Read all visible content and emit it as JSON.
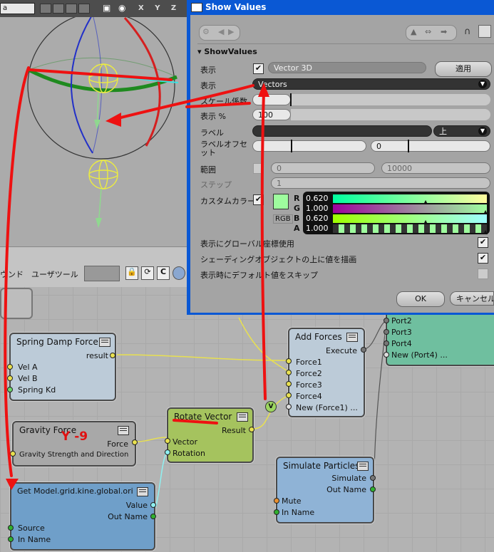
{
  "viewport": {
    "combo": "a",
    "axes_label": "X Y Z"
  },
  "node_toolbar": {
    "label1": "ウンド",
    "label2": "ユーザツール"
  },
  "nodes": {
    "spring_damp": {
      "title": "Spring Damp Force",
      "out": "result",
      "in": [
        "Vel A",
        "Vel B",
        "Spring Kd"
      ]
    },
    "gravity": {
      "title": "Gravity Force",
      "out": "Force",
      "in": [
        "Gravity Strength and Direction"
      ]
    },
    "get_model": {
      "title": "Get Model.grid.kine.global.ori",
      "out": [
        "Value",
        "Out Name"
      ],
      "in": [
        "Source",
        "In Name"
      ]
    },
    "rotate_vector": {
      "title": "Rotate Vector",
      "out": "Result",
      "in": [
        "Vector",
        "Rotation"
      ]
    },
    "add_forces": {
      "title": "Add Forces",
      "out": "Execute",
      "in": [
        "Force1",
        "Force2",
        "Force3",
        "Force4",
        "New (Force1) ..."
      ]
    },
    "simulate": {
      "title": "Simulate Particles",
      "out": [
        "Simulate",
        "Out Name"
      ],
      "in": [
        "Mute",
        "In Name"
      ]
    },
    "ports_node": {
      "ports": [
        "Port2",
        "Port3",
        "Port4",
        "New (Port4) ..."
      ]
    }
  },
  "annotations": {
    "handwritten": "Y -9",
    "v_badge": "V"
  },
  "dialog": {
    "title": "Show Values",
    "section": "ShowValues",
    "rows": {
      "display_label": "表示",
      "display_value": "Vector 3D",
      "apply_button": "適用",
      "display2_label": "表示",
      "display2_value": "Vectors",
      "scale_label": "スケール係数",
      "percent_label": "表示 %",
      "percent_value": "100",
      "label_label": "ラベル",
      "label_pos": "上",
      "label_offset_label": "ラベルオフセット",
      "label_offset_value": "0",
      "range_label": "範囲",
      "range_min": "0",
      "range_max": "10000",
      "step_label": "ステップ",
      "step_value": "1",
      "custom_color_label": "カスタムカラー",
      "rgb_label": "RGB"
    },
    "color": {
      "swatch": "#9efc9e",
      "channels": [
        {
          "name": "R",
          "value": "0.620"
        },
        {
          "name": "G",
          "value": "1.000"
        },
        {
          "name": "B",
          "value": "0.620"
        },
        {
          "name": "A",
          "value": "1.000"
        }
      ]
    },
    "checks": [
      {
        "label": "表示にグローバル座標使用",
        "checked": "✔"
      },
      {
        "label": "シェーディングオブジェクトの上に値を描画",
        "checked": "✔"
      },
      {
        "label": "表示時にデフォルト値をスキップ",
        "checked": ""
      }
    ],
    "ok_button": "OK",
    "cancel_button": "キャンセル"
  }
}
